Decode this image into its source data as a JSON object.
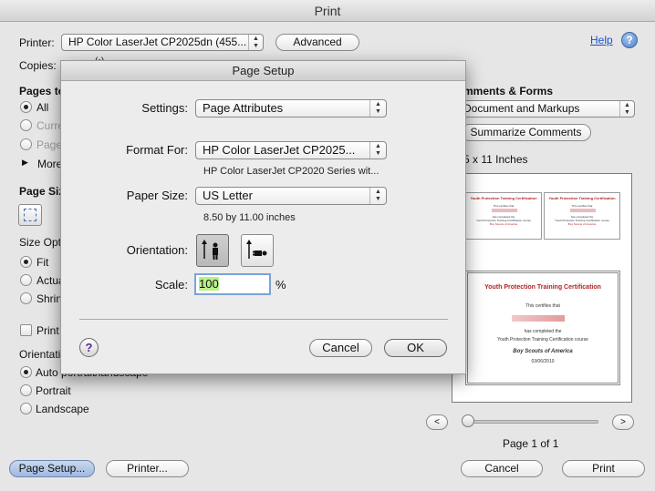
{
  "print": {
    "title": "Print",
    "printer_label": "Printer:",
    "printer_value": "HP Color LaserJet CP2025dn (455...",
    "advanced_label": "Advanced",
    "help_label": "Help",
    "copies_label": "Copies:",
    "copies_suffix": "(•)",
    "pages_label": "Pages to",
    "pages_options": [
      "All",
      "Curre",
      "Pages",
      "More"
    ],
    "page_size_label": "Page Siz",
    "size_options_label": "Size Opt",
    "size_options": [
      "Fit",
      "Actua",
      "Shrin"
    ],
    "print_checkbox_label": "Print",
    "orientation_label": "Orientati",
    "orientation_options": [
      "Auto portrait/landscape",
      "Portrait",
      "Landscape"
    ],
    "comments_label": "mments & Forms",
    "comments_value": "Document and Markups",
    "summarize_label": "Summarize Comments",
    "paper_info": "5 x 11 Inches",
    "page_indicator": "Page 1 of 1",
    "page_setup_label": "Page Setup...",
    "printer_button_label": "Printer...",
    "cancel_label": "Cancel",
    "print_label": "Print"
  },
  "preview": {
    "small_title": "Youth Protection Training Certification",
    "small_line1": "This certifies that",
    "small_line2": "has completed the",
    "small_line3": "Youth Protection Training Certification course",
    "small_line4": "Boy Scouts of America",
    "big_title": "Youth Protection Training Certification",
    "big_line1": "This certifies that",
    "big_line2": "has completed the",
    "big_line3": "Youth Protection Training Certification course",
    "big_org": "Boy Scouts of America",
    "big_date": "03/06/2010"
  },
  "page_setup": {
    "title": "Page Setup",
    "settings_label": "Settings:",
    "settings_value": "Page Attributes",
    "format_for_label": "Format For:",
    "format_for_value": "HP Color LaserJet CP2025...",
    "format_for_desc": "HP Color LaserJet CP2020 Series wit...",
    "paper_size_label": "Paper Size:",
    "paper_size_value": "US Letter",
    "paper_size_desc": "8.50 by 11.00 inches",
    "orientation_label": "Orientation:",
    "scale_label": "Scale:",
    "scale_value": "100",
    "scale_unit": "%",
    "help_symbol": "?",
    "cancel_label": "Cancel",
    "ok_label": "OK"
  },
  "colors": {
    "cert_title": "#b22222",
    "link": "#1a4fd0",
    "scale_highlight": "#b8f08c"
  }
}
